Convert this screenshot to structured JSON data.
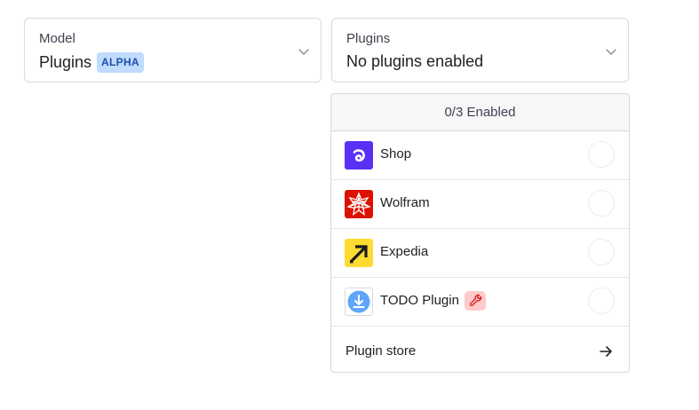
{
  "model_select": {
    "label": "Model",
    "value": "Plugins",
    "badge": "ALPHA"
  },
  "plugins_select": {
    "label": "Plugins",
    "value": "No plugins enabled"
  },
  "dropdown": {
    "header": "0/3 Enabled",
    "plugins": [
      {
        "name": "Shop",
        "icon": "shop-logo-icon",
        "color": "#5a31f4",
        "enabled": false
      },
      {
        "name": "Wolfram",
        "icon": "wolfram-logo-icon",
        "color": "#dd1100",
        "enabled": false
      },
      {
        "name": "Expedia",
        "icon": "expedia-logo-icon",
        "color": "#fddb32",
        "enabled": false
      },
      {
        "name": "TODO Plugin",
        "icon": "download-icon",
        "color": "#60a5fa",
        "enabled": false,
        "badge_icon": "wrench-icon"
      }
    ],
    "store": {
      "label": "Plugin store",
      "icon": "arrow-right-icon"
    }
  },
  "colors": {
    "badge_bg": "#bfdbfe",
    "badge_text": "#1e4fa8",
    "dev_badge_bg": "#fecaca",
    "border": "#d9d9e3"
  }
}
